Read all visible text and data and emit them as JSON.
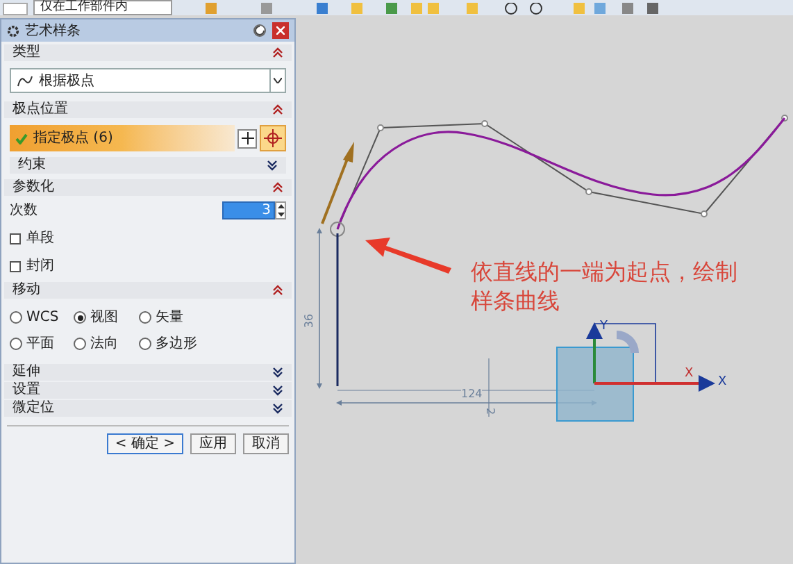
{
  "toolbar": {
    "combo_value": "仅在工作部件内"
  },
  "dialog": {
    "title": "艺术样条"
  },
  "sections": [
    {
      "kind": "dropdown",
      "title": "类型",
      "expanded": true,
      "value": "根据极点"
    },
    {
      "kind": "selection",
      "title": "极点位置",
      "expanded": true,
      "selection": {
        "label": "指定极点 (6)",
        "done": true
      },
      "sub": {
        "title": "约束",
        "expanded": false
      }
    },
    {
      "kind": "params",
      "title": "参数化",
      "expanded": true,
      "degree": {
        "label": "次数",
        "value": "3"
      },
      "checkboxes": [
        {
          "label": "单段",
          "checked": false
        },
        {
          "label": "封闭",
          "checked": false
        }
      ]
    },
    {
      "kind": "radios",
      "title": "移动",
      "expanded": true,
      "options": [
        {
          "label": "WCS",
          "selected": false
        },
        {
          "label": "视图",
          "selected": true
        },
        {
          "label": "矢量",
          "selected": false
        },
        {
          "label": "平面",
          "selected": false
        },
        {
          "label": "法向",
          "selected": false
        },
        {
          "label": "多边形",
          "selected": false
        }
      ]
    },
    {
      "kind": "header",
      "title": "延伸",
      "expanded": false
    },
    {
      "kind": "header",
      "title": "设置",
      "expanded": false
    },
    {
      "kind": "header",
      "title": "微定位",
      "expanded": false
    }
  ],
  "buttons": [
    {
      "label": "< 确定 >",
      "default": true
    },
    {
      "label": "应用",
      "default": false
    },
    {
      "label": "取消",
      "default": false
    }
  ],
  "canvas": {
    "annotation": "依直线的一端为起点，绘制样条曲线",
    "labels": [
      {
        "kind": "axis_y",
        "text": "Y"
      },
      {
        "kind": "axis_x",
        "text": "X"
      },
      {
        "kind": "handle_x",
        "text": "X"
      },
      {
        "kind": "dim_vertical",
        "text": "36"
      },
      {
        "kind": "dim_horizontal",
        "text": "124"
      },
      {
        "kind": "dim_small",
        "text": "2"
      }
    ]
  }
}
